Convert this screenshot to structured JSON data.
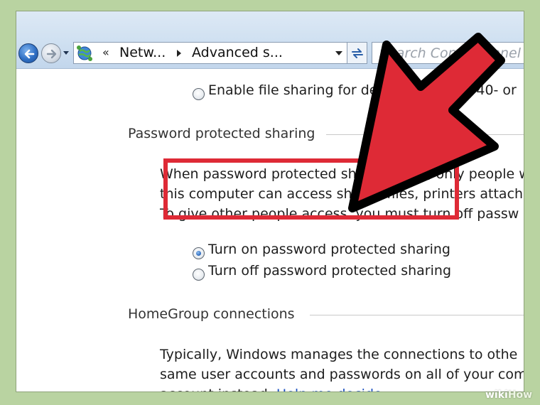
{
  "address_bar": {
    "overflow_chevron": "«",
    "crumbs": [
      "Netw...",
      "Advanced s..."
    ]
  },
  "search": {
    "placeholder": "Search Control Panel"
  },
  "content": {
    "media_option": {
      "label": "Enable file sharing for devices that use 40- or",
      "checked": false
    },
    "password_section": {
      "title": "Password protected sharing",
      "description": [
        "When password protected sharing is on, only people who",
        "this computer can access shared files, printers attached",
        "To give other people access, you must turn off passw"
      ],
      "options": [
        {
          "label": "Turn on password protected sharing",
          "checked": true
        },
        {
          "label": "Turn off password protected sharing",
          "checked": false
        }
      ]
    },
    "homegroup_section": {
      "title": "HomeGroup connections",
      "description": [
        "Typically, Windows manages the connections to othe",
        "same user accounts and passwords on all of your com",
        "account instead."
      ],
      "link": "Help me decide"
    }
  },
  "annotation": {
    "color": "#de2a36",
    "outline": "#000000"
  },
  "watermark": {
    "a": "wiki",
    "b": "How"
  },
  "icons": [
    "back-arrow-icon",
    "forward-arrow-icon",
    "network-icon",
    "refresh-icon"
  ]
}
